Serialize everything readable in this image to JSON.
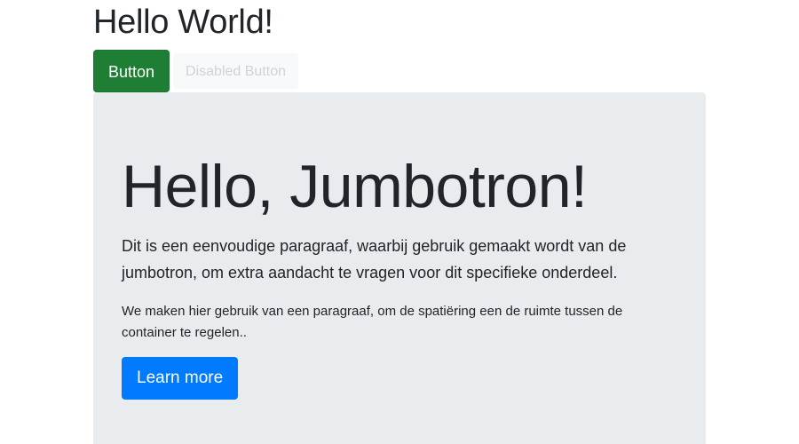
{
  "header": {
    "title": "Hello World!"
  },
  "buttons": {
    "primary_label": "Button",
    "disabled_label": "Disabled Button"
  },
  "jumbotron": {
    "title": "Hello, Jumbotron!",
    "lead": "Dit is een eenvoudige paragraaf, waarbij gebruik gemaakt wordt van de jumbotron, om extra aandacht te vragen voor dit specifieke onderdeel.",
    "text": "We maken hier gebruik van een paragraaf, om de spatiëring een de ruimte tussen de container te regelen..",
    "cta_label": "Learn more"
  },
  "colors": {
    "success": "#1e7e34",
    "primary": "#007bff",
    "jumbotron_bg": "#e9ecef",
    "disabled_text": "#cfd3d6"
  }
}
